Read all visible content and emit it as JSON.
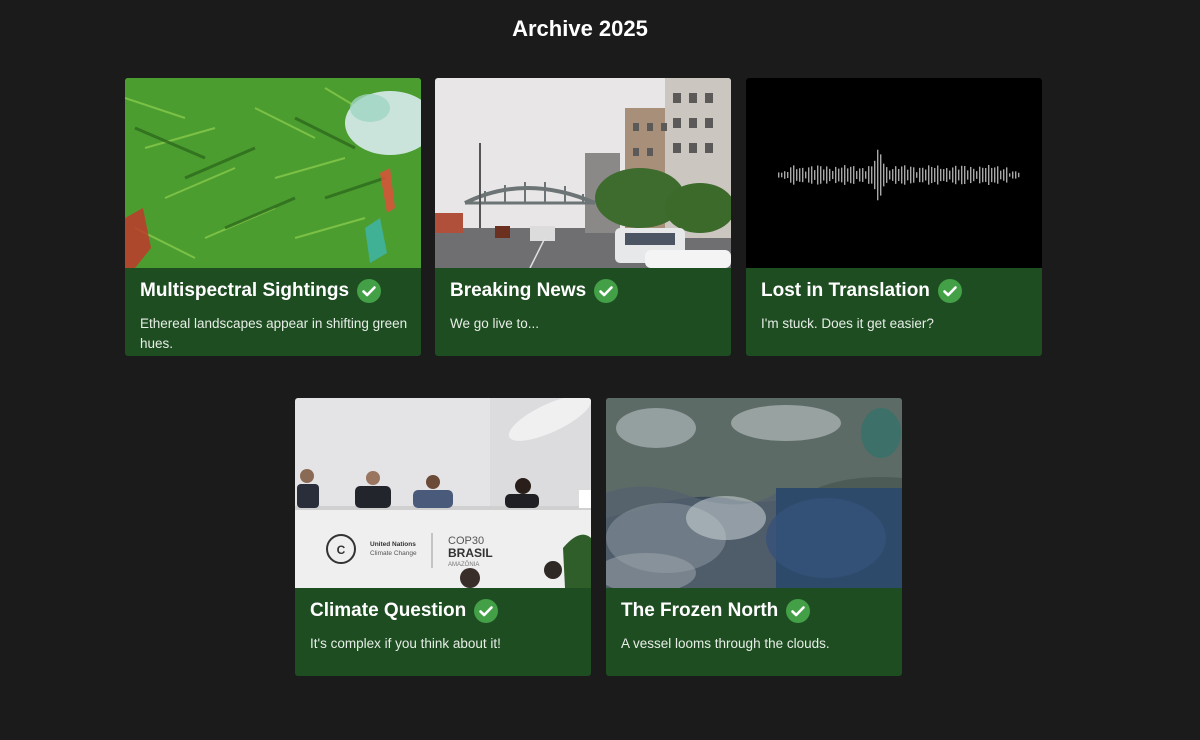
{
  "page": {
    "title": "Archive 2025"
  },
  "cards": [
    {
      "title": "Multispectral Sightings",
      "description": "Ethereal landscapes appear in shifting green hues.",
      "completed": true,
      "thumbnail_icon": "multispectral-foliage-image"
    },
    {
      "title": "Breaking News",
      "description": "We go live to...",
      "completed": true,
      "thumbnail_icon": "city-street-image"
    },
    {
      "title": "Lost in Translation",
      "description": "I'm stuck. Does it get easier?",
      "completed": true,
      "thumbnail_icon": "audio-waveform-image"
    },
    {
      "title": "Climate Question",
      "description": "It's complex if you think about it!",
      "completed": true,
      "thumbnail_icon": "press-conference-image"
    },
    {
      "title": "The Frozen North",
      "description": "A vessel looms through the clouds.",
      "completed": true,
      "thumbnail_icon": "satellite-ice-image"
    }
  ],
  "thumbnail_texts": {
    "unfccc_line1": "United Nations",
    "unfccc_line2": "Climate Change",
    "cop_line1": "COP30",
    "cop_line2": "BRASIL",
    "cop_line3": "AMAZÔNIA"
  },
  "colors": {
    "background": "#1b1b1b",
    "card_footer": "#1f4d22",
    "check_badge": "#43a047"
  }
}
